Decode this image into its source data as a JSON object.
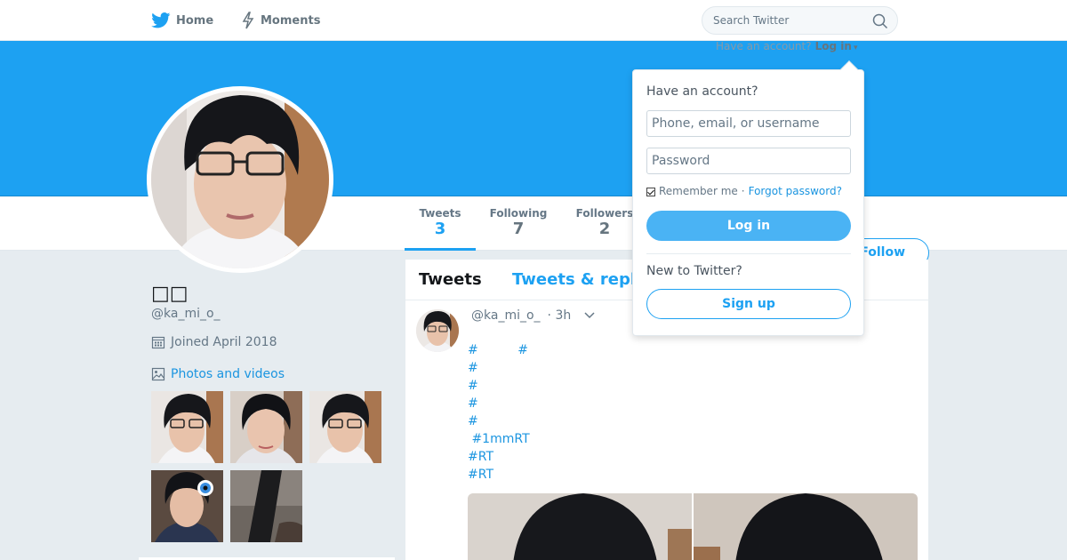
{
  "nav": {
    "home_label": "Home",
    "moments_label": "Moments",
    "search_placeholder": "Search Twitter",
    "have_account": "Have an account?",
    "login_link": "Log in"
  },
  "profile": {
    "name": "□□",
    "handle": "@ka_mi_o_",
    "joined": "Joined April 2018",
    "photos_label": "Photos and videos",
    "follow_label": "Follow"
  },
  "stats": [
    {
      "label": "Tweets",
      "value": "3"
    },
    {
      "label": "Following",
      "value": "7"
    },
    {
      "label": "Followers",
      "value": "2"
    }
  ],
  "timeline": {
    "tabs": [
      "Tweets",
      "Tweets & repl"
    ],
    "tweet": {
      "handle": "@ka_mi_o_",
      "time": "· 3h",
      "lines": [
        "#          #",
        "#",
        "#",
        "#",
        "#",
        " #1mmRT",
        "#RT",
        "#RT"
      ]
    }
  },
  "login_popup": {
    "title": "Have an account?",
    "username_placeholder": "Phone, email, or username",
    "password_placeholder": "Password",
    "remember_label": "Remember me",
    "separator": "·",
    "forgot_label": "Forgot password?",
    "login_button": "Log in",
    "new_label": "New to Twitter?",
    "signup_button": "Sign up"
  },
  "colors": {
    "brand": "#1da1f2",
    "link": "#1b95e0"
  }
}
